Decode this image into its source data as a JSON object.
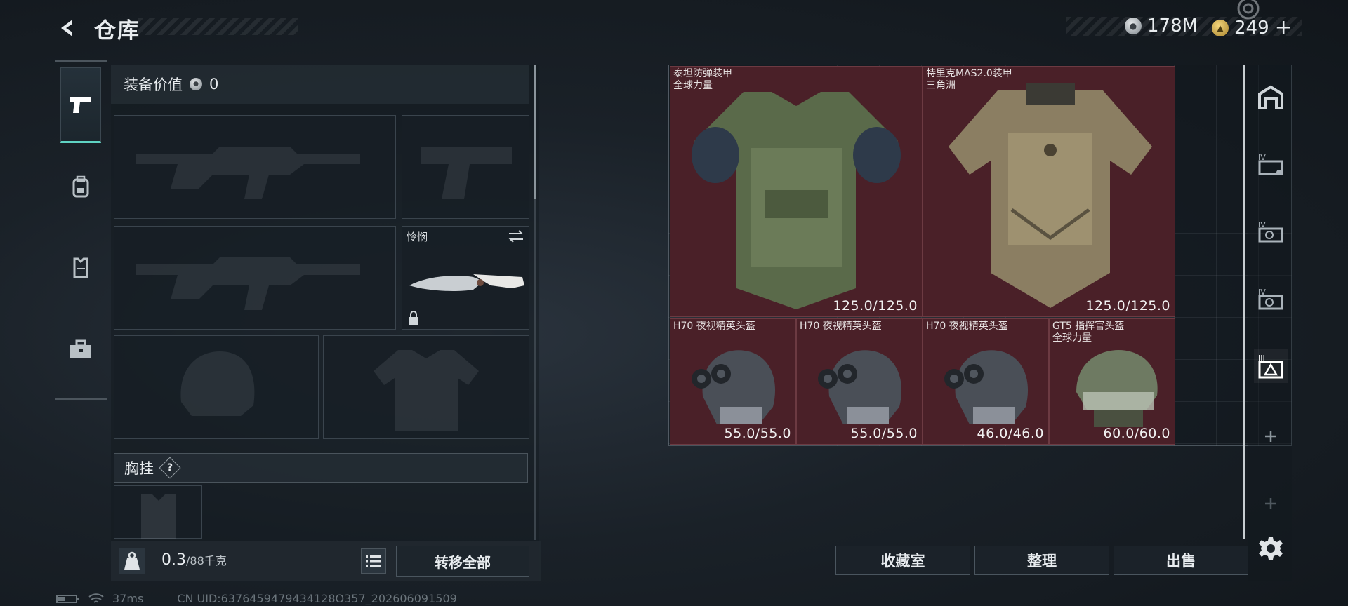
{
  "header": {
    "title": "仓库",
    "currency_silver": "178M",
    "currency_gold": "249",
    "gold_plus": "+"
  },
  "loadout": {
    "value_label": "装备价值",
    "value": "0",
    "melee_label": "怜悯",
    "chest_rig_label": "胸挂",
    "help_mark": "?",
    "weight_current": "0.3",
    "weight_max": "/88千克",
    "transfer_all": "转移全部"
  },
  "storage": {
    "items": [
      {
        "name": "泰坦防弹装甲",
        "sub": "全球力量",
        "durability": "125.0/125.0"
      },
      {
        "name": "特里克MAS2.0装甲",
        "sub": "三角洲",
        "durability": "125.0/125.0"
      },
      {
        "name": "H70 夜视精英头盔",
        "sub": "",
        "durability": "55.0/55.0"
      },
      {
        "name": "H70 夜视精英头盔",
        "sub": "",
        "durability": "55.0/55.0"
      },
      {
        "name": "H70 夜视精英头盔",
        "sub": "",
        "durability": "46.0/46.0"
      },
      {
        "name": "GT5 指挥官头盔",
        "sub": "全球力量",
        "durability": "60.0/60.0"
      }
    ]
  },
  "actions": {
    "collection": "收藏室",
    "organize": "整理",
    "sell": "出售"
  },
  "status": {
    "ping": "37ms",
    "uid": "CN UID:6376459479434128O357_202606091509"
  },
  "colors": {
    "item_bg": "#4a2028",
    "accent": "#5fd3c3"
  }
}
